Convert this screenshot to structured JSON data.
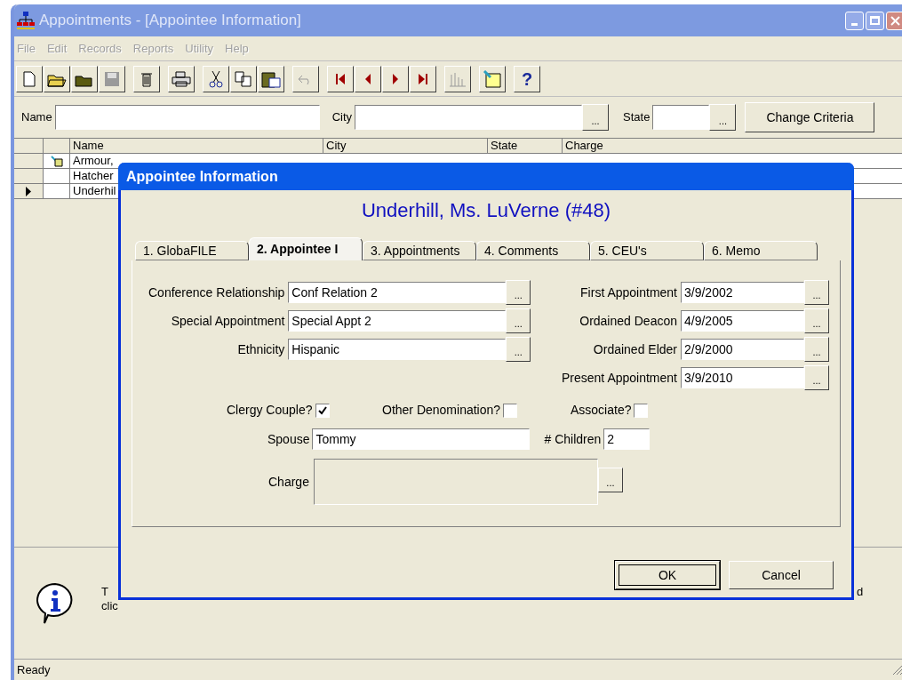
{
  "window": {
    "title": "Appointments - [Appointee Information]",
    "active": false
  },
  "menu": [
    {
      "label": "File",
      "disabled": true
    },
    {
      "label": "Edit",
      "disabled": true
    },
    {
      "label": "Records",
      "disabled": true
    },
    {
      "label": "Reports",
      "disabled": true
    },
    {
      "label": "Utility",
      "disabled": true
    },
    {
      "label": "Help",
      "disabled": true
    }
  ],
  "toolbar": [
    {
      "kind": "new",
      "disabled": false
    },
    {
      "kind": "open",
      "disabled": false
    },
    {
      "kind": "folder",
      "disabled": false
    },
    {
      "kind": "save",
      "disabled": true
    },
    {
      "kind": "sep"
    },
    {
      "kind": "delete",
      "disabled": false
    },
    {
      "kind": "sep"
    },
    {
      "kind": "print",
      "disabled": false
    },
    {
      "kind": "sep"
    },
    {
      "kind": "cut",
      "disabled": false
    },
    {
      "kind": "copy",
      "disabled": false
    },
    {
      "kind": "paste",
      "disabled": false
    },
    {
      "kind": "sep"
    },
    {
      "kind": "undo",
      "disabled": true
    },
    {
      "kind": "sep"
    },
    {
      "kind": "first",
      "disabled": false
    },
    {
      "kind": "prev",
      "disabled": false
    },
    {
      "kind": "next",
      "disabled": false
    },
    {
      "kind": "last",
      "disabled": false
    },
    {
      "kind": "sep"
    },
    {
      "kind": "chart",
      "disabled": true
    },
    {
      "kind": "sep"
    },
    {
      "kind": "note",
      "disabled": false
    },
    {
      "kind": "sep"
    },
    {
      "kind": "help",
      "label": "?",
      "disabled": false
    }
  ],
  "search": {
    "name_label": "Name",
    "city_label": "City",
    "state_label": "State",
    "browse": "...",
    "button": "Change Criteria"
  },
  "grid": {
    "columns": [
      "Name",
      "City",
      "State",
      "Charge"
    ],
    "rows": [
      {
        "name": "Armour,",
        "has_note": true,
        "current": false
      },
      {
        "name": "Hatcher",
        "has_note": false,
        "current": false
      },
      {
        "name": "Underhil",
        "has_note": false,
        "current": true
      }
    ]
  },
  "info": {
    "line_1": "T",
    "line_2": "clic",
    "right": "d"
  },
  "status_bar": "Ready",
  "dialog": {
    "title": "Appointee Information",
    "heading": "Underhill, Ms. LuVerne (#48)",
    "tabs": [
      {
        "label": "1. GlobaFILE",
        "selected": false
      },
      {
        "label": "2. Appointee I",
        "selected": true
      },
      {
        "label": "3. Appointments",
        "selected": false
      },
      {
        "label": "4. Comments",
        "selected": false
      },
      {
        "label": "5. CEU's",
        "selected": false
      },
      {
        "label": "6. Memo",
        "selected": false
      }
    ],
    "left_fields": [
      {
        "label": "Conference Relationship",
        "value": "Conf Relation 2"
      },
      {
        "label": "Special Appointment",
        "value": "Special Appt 2"
      },
      {
        "label": "Ethnicity",
        "value": "Hispanic"
      }
    ],
    "right_fields": [
      {
        "label": "First Appointment",
        "value": "3/9/2002"
      },
      {
        "label": "Ordained Deacon",
        "value": "4/9/2005"
      },
      {
        "label": "Ordained Elder",
        "value": "2/9/2000"
      },
      {
        "label": "Present Appointment",
        "value": "3/9/2010"
      }
    ],
    "browse": "...",
    "checkboxes": [
      {
        "label": "Clergy Couple?",
        "checked": true
      },
      {
        "label": "Other Denomination?",
        "checked": false
      },
      {
        "label": "Associate?",
        "checked": false
      }
    ],
    "spouse": {
      "label": "Spouse",
      "value": "Tommy"
    },
    "children": {
      "label": "# Children",
      "value": "2"
    },
    "charge": {
      "label": "Charge"
    },
    "buttons": [
      {
        "label": "OK",
        "default": true
      },
      {
        "label": "Cancel",
        "default": false
      }
    ]
  }
}
